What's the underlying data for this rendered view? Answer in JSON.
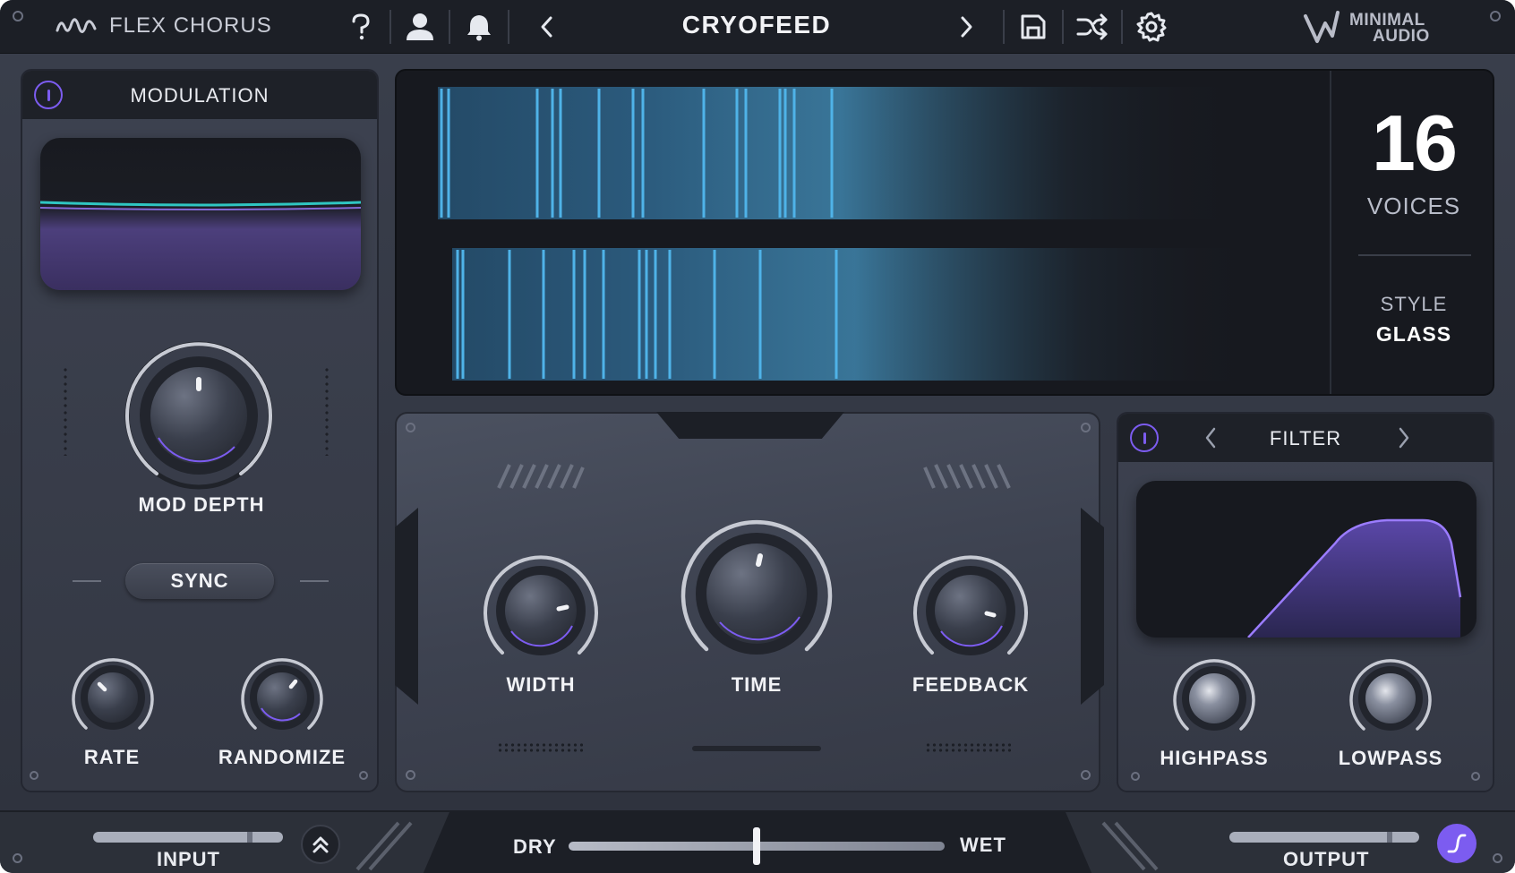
{
  "app": {
    "name": "FLEX CHORUS",
    "preset": "CRYOFEED",
    "brand_line1": "MINIMAL",
    "brand_line2": "AUDIO"
  },
  "toolbar": {
    "icons": [
      "help-icon",
      "user-icon",
      "bell-icon",
      "chevron-left-icon",
      "chevron-right-icon",
      "save-icon",
      "shuffle-icon",
      "gear-icon"
    ]
  },
  "modulation": {
    "title": "MODULATION",
    "enabled": true,
    "mod_depth_label": "MOD DEPTH",
    "sync_label": "SYNC",
    "rate_label": "RATE",
    "randomize_label": "RANDOMIZE"
  },
  "display": {
    "voices_value": "16",
    "voices_label": "VOICES",
    "style_label": "STYLE",
    "style_value": "GLASS"
  },
  "main": {
    "width_label": "WIDTH",
    "time_label": "TIME",
    "feedback_label": "FEEDBACK"
  },
  "filter": {
    "title": "FILTER",
    "enabled": true,
    "highpass_label": "HIGHPASS",
    "lowpass_label": "LOWPASS"
  },
  "bottom": {
    "input_label": "INPUT",
    "dry_label": "DRY",
    "wet_label": "WET",
    "output_label": "OUTPUT",
    "mix_fraction": 0.5
  },
  "colors": {
    "accent": "#7c5cf0",
    "teal": "#2fc6c2",
    "band_blue": "#4fb3e8"
  }
}
